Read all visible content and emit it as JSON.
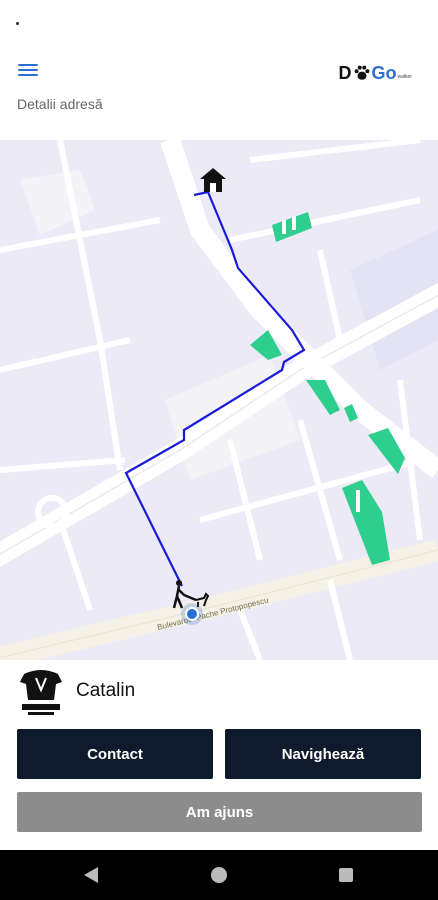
{
  "header": {
    "menu_icon": "hamburger-menu-icon",
    "logo": {
      "part1": "D",
      "paw_icon": "paw-icon",
      "part2": "Go",
      "small": "walker"
    },
    "subtitle": "Detalii adresă"
  },
  "map": {
    "street_label": "Bulevardul Pache Protopopescu",
    "home_icon": "house-icon",
    "walker_icon": "dog-walker-icon",
    "location_icon": "location-dot-icon",
    "route_color": "#1a1adb",
    "park_color": "#2ecf8e",
    "road_color": "#ffffff",
    "background_color": "#eceaf7"
  },
  "driver": {
    "avatar_icon": "walker-avatar-icon",
    "name": "Catalin"
  },
  "actions": {
    "contact_label": "Contact",
    "navigate_label": "Navighează",
    "arrived_label": "Am ajuns"
  },
  "colors": {
    "primary_dark": "#0f1b2d",
    "disabled_gray": "#8c8c8c",
    "accent_blue": "#2b6fd6"
  }
}
